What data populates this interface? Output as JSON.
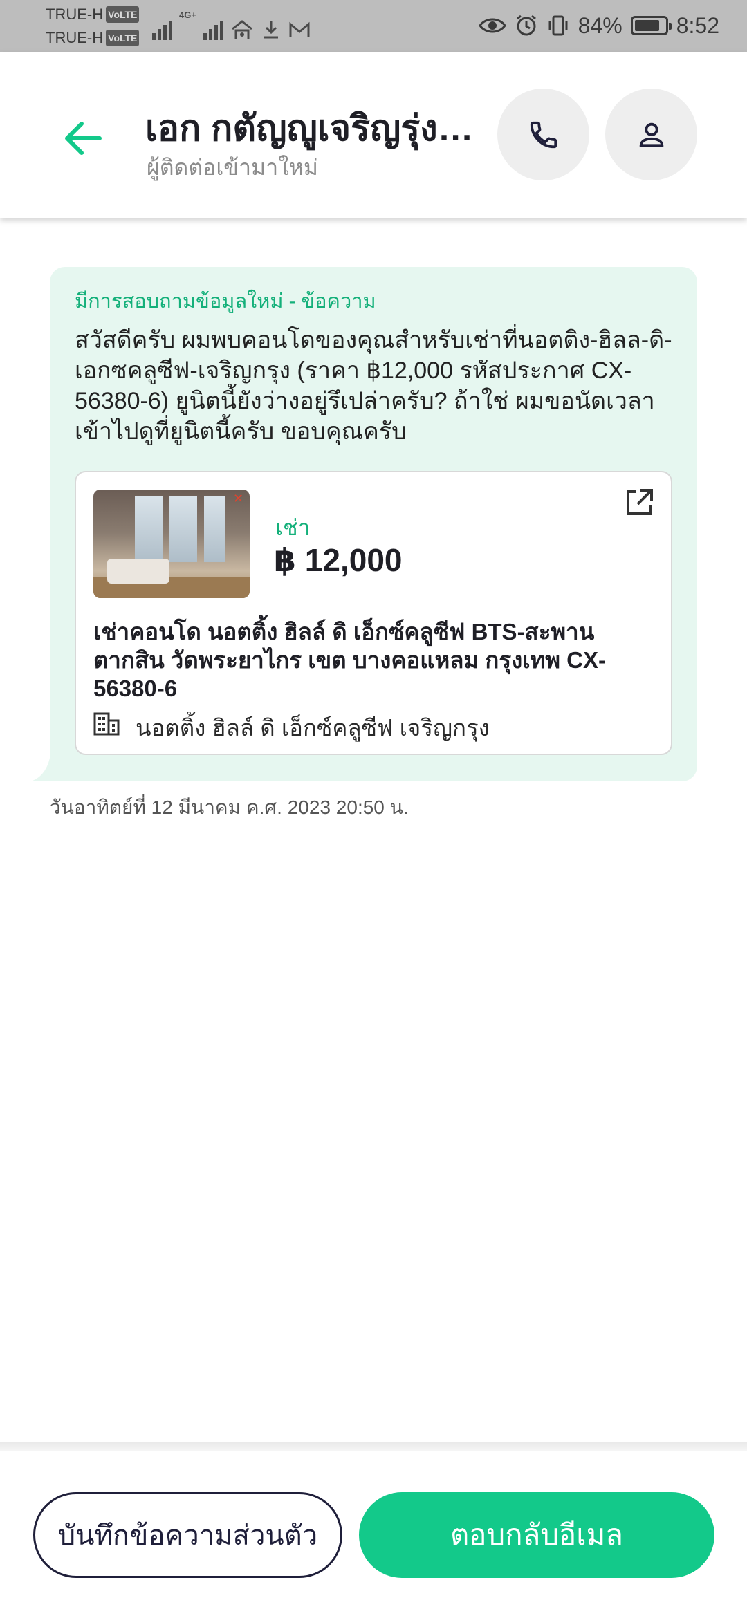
{
  "status_bar": {
    "carrier_1": "TRUE-H",
    "carrier_2": "TRUE-H",
    "volte_badge": "VoLTE",
    "network_label": "4G+",
    "battery_percent": "84%",
    "battery_level": 0.84,
    "time": "8:52"
  },
  "header": {
    "contact_name": "เอก  กตัญญูเจริญรุ่งเรือง",
    "contact_subtitle": "ผู้ติดต่อเข้ามาใหม่",
    "back_icon": "arrow-left-icon",
    "call_icon": "phone-icon",
    "profile_icon": "person-icon"
  },
  "message": {
    "label": "มีการสอบถามข้อมูลใหม่ - ข้อความ",
    "body": "สวัสดีครับ ผมพบคอนโดของคุณสำหรับเช่าที่นอตติง-ฮิลล-ดิ-เอกซคลูซีฟ-เจริญกรุง (ราคา ฿12,000 รหัสประกาศ CX-56380-6) ยูนิตนี้ยังว่างอยู่รึเปล่าครับ? ถ้าใช่ ผมขอนัดเวลาเข้าไปดูที่ยูนิตนี้ครับ ขอบคุณครับ",
    "timestamp": "วันอาทิตย์ที่ 12 มีนาคม ค.ศ. 2023 20:50 น."
  },
  "listing": {
    "type": "เช่า",
    "price": "฿ 12,000",
    "title": "เช่าคอนโด  นอตติ้ง ฮิลล์ ดิ เอ็กซ์คลูซีฟ BTS-สะพานตากสิน วัดพระยาไกร เขต บางคอแหลม กรุงเทพ CX-56380-6",
    "project": "นอตติ้ง ฮิลล์ ดิ เอ็กซ์คลูซีฟ เจริญกรุง",
    "open_icon": "open-in-new-icon",
    "building_icon": "building-icon"
  },
  "actions": {
    "note_label": "บันทึกข้อความส่วนตัว",
    "reply_label": "ตอบกลับอีเมล"
  },
  "colors": {
    "accent": "#13c98a",
    "bubble_bg": "#e6f7f0",
    "dark": "#1f1f3a"
  }
}
